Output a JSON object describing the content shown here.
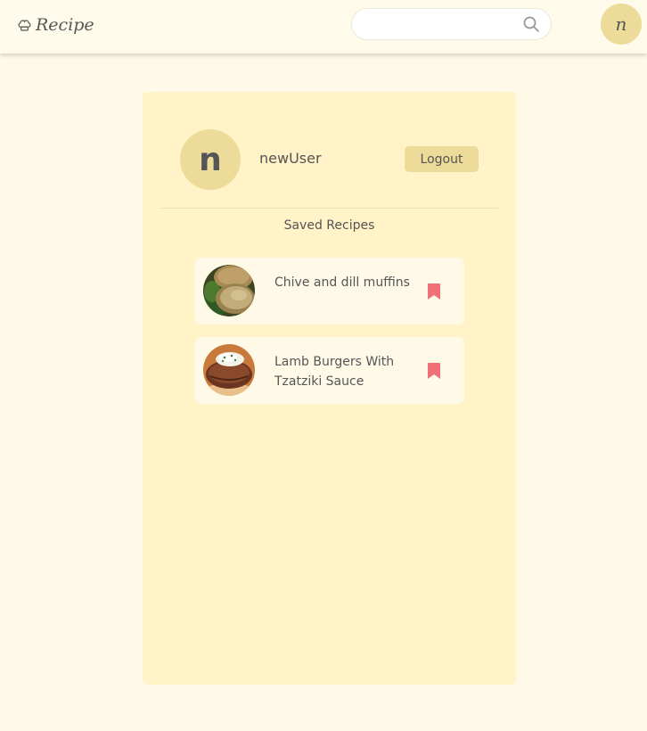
{
  "header": {
    "brand": "Recipe",
    "search": {
      "value": "",
      "placeholder": ""
    },
    "avatar_initial": "n"
  },
  "profile": {
    "avatar_initial": "n",
    "username": "newUser",
    "logout_label": "Logout",
    "saved_title": "Saved Recipes"
  },
  "saved_recipes": [
    {
      "title": "Chive and dill muffins",
      "image": "muffins-photo",
      "bookmark_icon": "bookmark-filled-icon"
    },
    {
      "title": "Lamb Burgers With Tzatziki Sauce",
      "image": "lamb-burger-photo",
      "bookmark_icon": "bookmark-filled-icon"
    }
  ],
  "colors": {
    "page_bg": "#fffae8",
    "card_bg": "#fff3c7",
    "accent": "#ecdb99",
    "bookmark": "#f07078",
    "text": "#555555"
  }
}
